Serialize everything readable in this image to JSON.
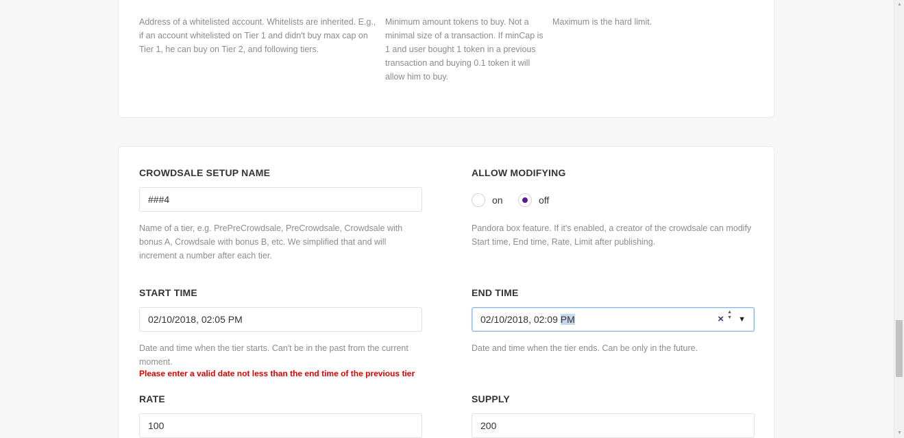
{
  "whitelist": {
    "address_help": "Address of a whitelisted account. Whitelists are inherited. E.g., if an account whitelisted on Tier 1 and didn't buy max cap on Tier 1, he can buy on Tier 2, and following tiers.",
    "min_help": "Minimum amount tokens to buy. Not a minimal size of a transaction. If minCap is 1 and user bought 1 token in a previous transaction and buying 0.1 token it will allow him to buy.",
    "max_help": "Maximum is the hard limit."
  },
  "tier": {
    "setup_name_label": "CROWDSALE SETUP NAME",
    "setup_name_value": "###4",
    "setup_name_help": "Name of a tier, e.g. PrePreCrowdsale, PreCrowdsale, Crowdsale with bonus A, Crowdsale with bonus B, etc. We simplified that and will increment a number after each tier.",
    "allow_modifying_label": "ALLOW MODIFYING",
    "radio_on_label": "on",
    "radio_off_label": "off",
    "allow_modifying_selected": "off",
    "allow_modifying_help": "Pandora box feature. If it's enabled, a creator of the crowdsale can modify Start time, End time, Rate, Limit after publishing.",
    "start_time_label": "START TIME",
    "start_time_value": "02/10/2018, 02:05 PM",
    "start_time_help": "Date and time when the tier starts. Can't be in the past from the current moment.",
    "start_time_error": "Please enter a valid date not less than the end time of the previous tier",
    "end_time_label": "END TIME",
    "end_time_value_main": "02/10/2018, 02:09",
    "end_time_value_selected": "PM",
    "end_time_help": "Date and time when the tier ends. Can be only in the future.",
    "rate_label": "RATE",
    "rate_value": "100",
    "supply_label": "SUPPLY",
    "supply_value": "200"
  },
  "icons": {
    "clear": "×",
    "spin_up": "▲",
    "spin_down": "▼",
    "dropdown": "▼",
    "scroll_up": "▲",
    "scroll_down": "▼"
  },
  "colors": {
    "error": "#e00000",
    "radio_selected": "#5a1a9a",
    "primary_button": "#1c94ea"
  }
}
